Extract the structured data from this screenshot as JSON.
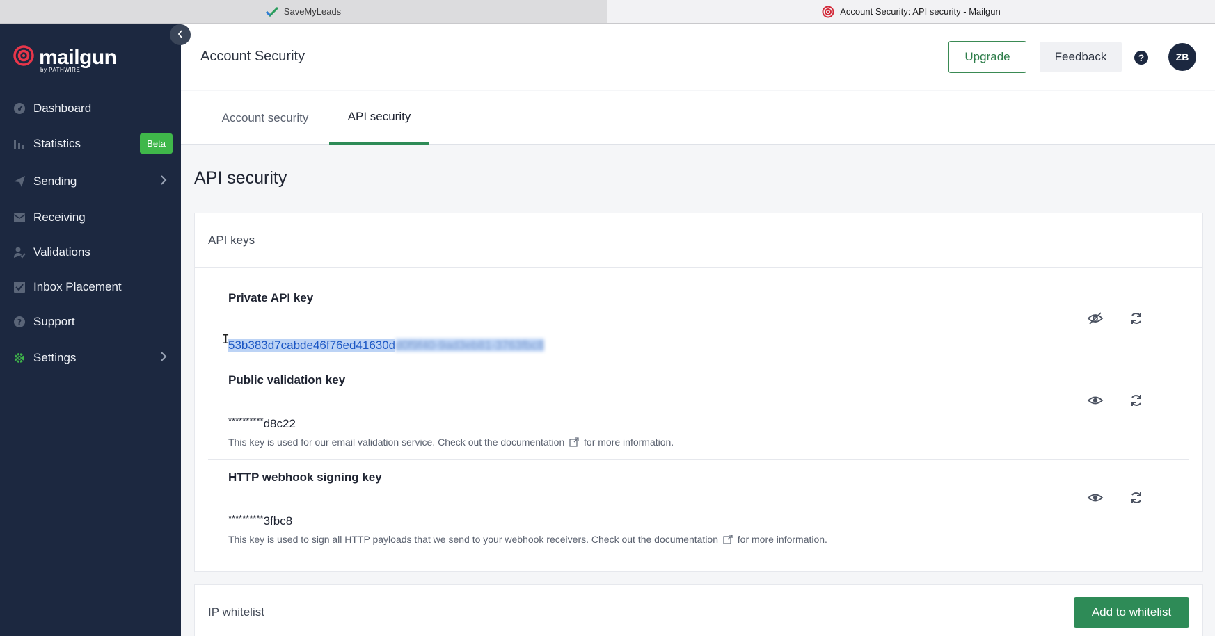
{
  "browser": {
    "tabs": [
      {
        "title": "SaveMyLeads",
        "icon": "checkmark-favicon-icon",
        "active": false
      },
      {
        "title": "Account Security: API security - Mailgun",
        "icon": "mailgun-favicon-icon",
        "active": true
      }
    ]
  },
  "sidebar": {
    "logo": "mailgun",
    "logo_sub": "by PATHWIRE",
    "items": [
      {
        "label": "Dashboard",
        "icon": "dashboard-icon"
      },
      {
        "label": "Statistics",
        "icon": "bar-chart-icon",
        "badge": "Beta"
      },
      {
        "label": "Sending",
        "icon": "paper-plane-icon",
        "expandable": true
      },
      {
        "label": "Receiving",
        "icon": "inbox-icon"
      },
      {
        "label": "Validations",
        "icon": "user-check-icon"
      },
      {
        "label": "Inbox Placement",
        "icon": "checkbox-icon"
      },
      {
        "label": "Support",
        "icon": "help-circle-icon"
      },
      {
        "label": "Settings",
        "icon": "gear-icon",
        "expandable": true
      }
    ]
  },
  "header": {
    "title": "Account Security",
    "upgrade_label": "Upgrade",
    "feedback_label": "Feedback",
    "help_symbol": "?",
    "avatar_initials": "ZB"
  },
  "subtabs": [
    {
      "label": "Account security",
      "active": false
    },
    {
      "label": "API security",
      "active": true
    }
  ],
  "main": {
    "section_title": "API security",
    "api_keys": {
      "title": "API keys",
      "keys": [
        {
          "title": "Private API key",
          "value_visible": "53b383d7cabde46f76ed41630d",
          "value_blurred": "d0f9f40-9ad3eb81-3763fbc8",
          "selected": true,
          "visibility_icon": "eye-off-icon",
          "refresh_icon": "refresh-icon"
        },
        {
          "title": "Public validation key",
          "masked": "**********",
          "suffix": "d8c22",
          "desc_before": "This key is used for our email validation service. Check out the documentation",
          "desc_after": "for more information.",
          "visibility_icon": "eye-icon",
          "refresh_icon": "refresh-icon"
        },
        {
          "title": "HTTP webhook signing key",
          "masked": "**********",
          "suffix": "3fbc8",
          "desc_before": "This key is used to sign all HTTP payloads that we send to your webhook receivers. Check out the documentation",
          "desc_after": "for more information.",
          "visibility_icon": "eye-icon",
          "refresh_icon": "refresh-icon"
        }
      ]
    },
    "ip_whitelist": {
      "title": "IP whitelist",
      "add_label": "Add to whitelist"
    }
  },
  "colors": {
    "sidebar_bg": "#1c2840",
    "accent_green": "#2e8b57",
    "badge_green": "#3fb74a",
    "selection": "#bcd3f5"
  }
}
